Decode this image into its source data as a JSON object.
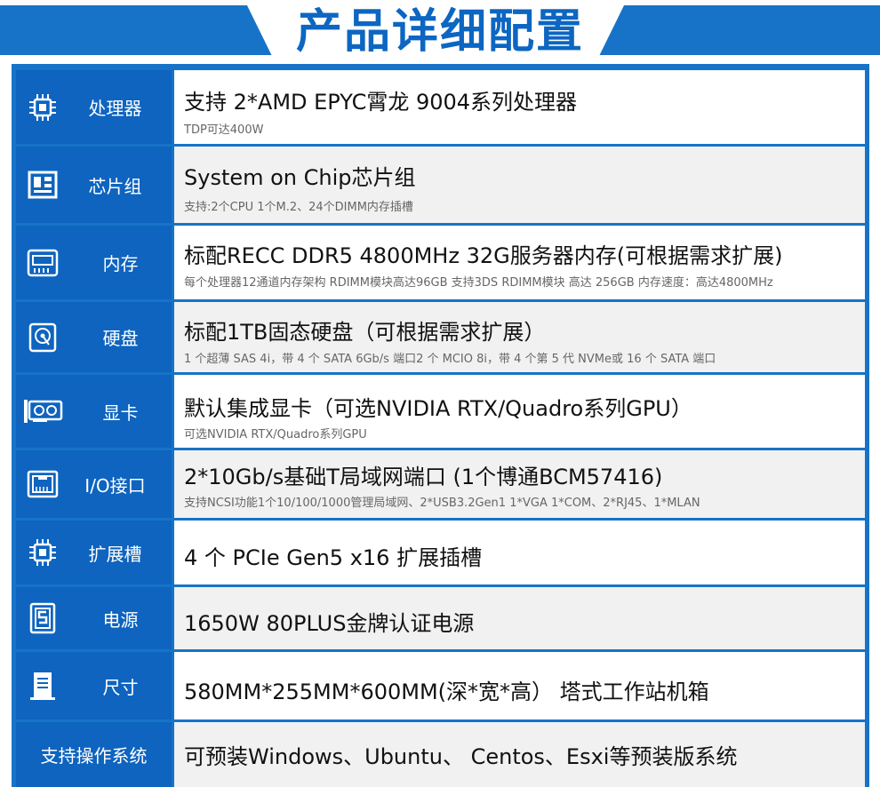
{
  "title": "产品详细配置",
  "rows": [
    {
      "label": "处理器",
      "main": "支持 2*AMD EPYC霄龙 9004系列处理器",
      "sub": "TDP可达400W",
      "icon": "cpu-icon"
    },
    {
      "label": "芯片组",
      "main": "System on Chip芯片组",
      "sub": "支持:2个CPU 1个M.2、24个DIMM内存插槽",
      "icon": "motherboard-icon"
    },
    {
      "label": "内存",
      "main": "标配RECC DDR5 4800MHz 32G服务器内存(可根据需求扩展)",
      "sub": "每个处理器12通道内存架构 RDIMM模块高达96GB 支持3DS RDIMM模块 高达 256GB 内存速度：高达4800MHz",
      "icon": "memory-icon"
    },
    {
      "label": "硬盘",
      "main": "标配1TB固态硬盘（可根据需求扩展）",
      "sub": "1 个超薄 SAS 4i，带 4 个 SATA 6Gb/s 端口2 个 MCIO 8i，带 4 个第 5 代 NVMe或 16 个 SATA 端口",
      "icon": "hard-disk-icon"
    },
    {
      "label": "显卡",
      "main": "默认集成显卡（可选NVIDIA RTX/Quadro系列GPU）",
      "sub": "可选NVIDIA RTX/Quadro系列GPU",
      "icon": "graphics-card-icon"
    },
    {
      "label": "I/O接口",
      "main": "2*10Gb/s基础T局域网端口 (1个博通BCM57416)",
      "sub": "支持NCSI功能1个10/100/1000管理局域网、2*USB3.2Gen1 1*VGA 1*COM、2*RJ45、1*MLAN",
      "icon": "ethernet-port-icon"
    },
    {
      "label": "扩展槽",
      "main": "4 个 PCIe Gen5 x16 扩展插槽",
      "sub": "",
      "icon": "cpu-icon"
    },
    {
      "label": "电源",
      "main": "1650W 80PLUS金牌认证电源",
      "sub": "",
      "icon": "power-supply-icon"
    },
    {
      "label": "尺寸",
      "main": "580MM*255MM*600MM(深*宽*高） 塔式工作站机箱",
      "sub": "",
      "icon": "tower-chassis-icon"
    },
    {
      "label": "支持操作系统",
      "main": "可预装Windows、Ubuntu、 Centos、Esxi等预装版系统",
      "sub": "",
      "icon": ""
    }
  ],
  "colors": {
    "brand_blue": "#1773c7",
    "label_blue": "#0e64bf",
    "title_blue": "#0c66c2"
  }
}
